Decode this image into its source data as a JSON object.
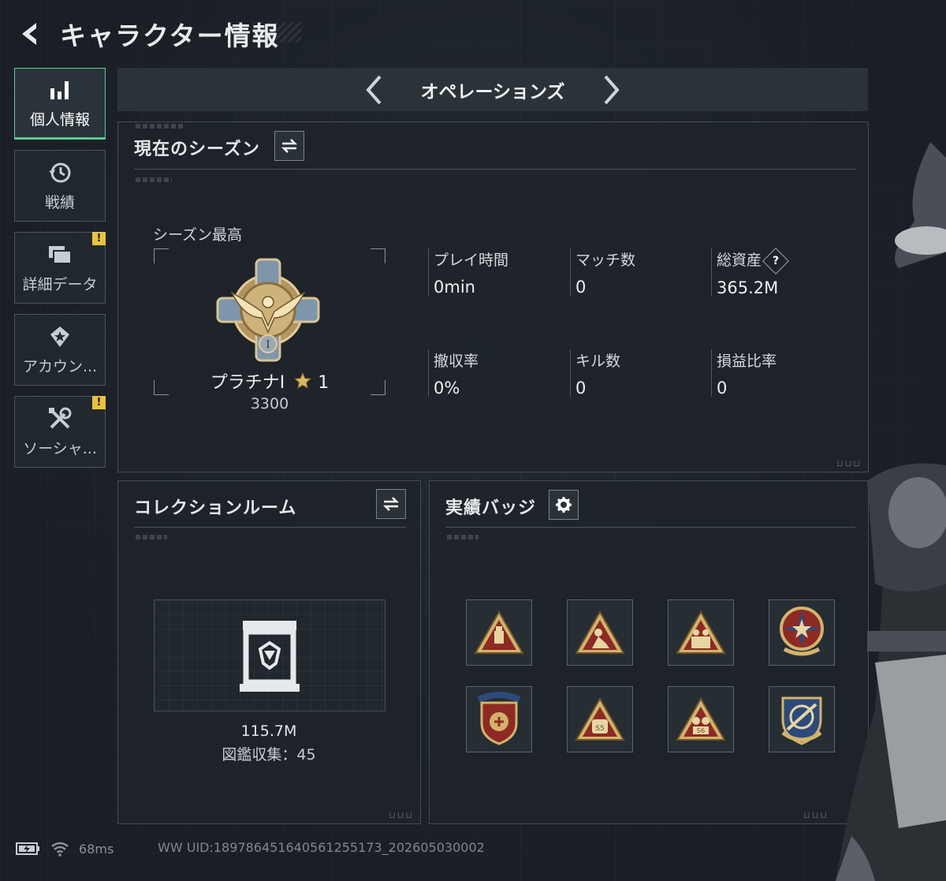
{
  "header": {
    "title": "キャラクター情報"
  },
  "sidebar": {
    "items": [
      {
        "label": "個人情報",
        "icon": "bar-chart-icon",
        "active": true,
        "alert": false
      },
      {
        "label": "戦績",
        "icon": "history-clock-icon",
        "active": false,
        "alert": false
      },
      {
        "label": "詳細データ",
        "icon": "folder-stack-icon",
        "active": false,
        "alert": true
      },
      {
        "label": "アカウン...",
        "icon": "shield-star-icon",
        "active": false,
        "alert": false
      },
      {
        "label": "ソーシャ...",
        "icon": "wrench-tools-icon",
        "active": false,
        "alert": true
      }
    ],
    "alert_mark": "!"
  },
  "mode_selector": {
    "label": "オペレーションズ"
  },
  "season": {
    "title": "現在のシーズン",
    "best_label": "シーズン最高",
    "rank": {
      "name": "プラチナI",
      "stars": "1",
      "score": "3300",
      "numeral": "I"
    },
    "stats": [
      {
        "label": "プレイ時間",
        "value": "0min"
      },
      {
        "label": "マッチ数",
        "value": "0"
      },
      {
        "label": "総資産",
        "value": "365.2M",
        "help": "?"
      },
      {
        "label": "撤収率",
        "value": "0%"
      },
      {
        "label": "キル数",
        "value": "0"
      },
      {
        "label": "損益比率",
        "value": "0"
      }
    ]
  },
  "collection": {
    "title": "コレクションルーム",
    "value": "115.7M",
    "count_text": "図鑑収集：45"
  },
  "badges": {
    "title": "実績バッジ",
    "items": [
      "usb-triangle-badge-icon",
      "mortar-triangle-badge-icon",
      "soldiers-triangle-badge-icon",
      "star-crest-badge-icon",
      "stars-shield-badge-icon",
      "s5-triangle-badge-icon",
      "s6-triangle-badge-icon",
      "crosshair-shield-badge-icon"
    ]
  },
  "footer": {
    "ping": "68ms",
    "uid": "WW UID:1897864516405612551​73_202605030002"
  },
  "colors": {
    "accent": "#5ec793",
    "warn": "#e8c33b",
    "gold": "#c9a45a"
  }
}
